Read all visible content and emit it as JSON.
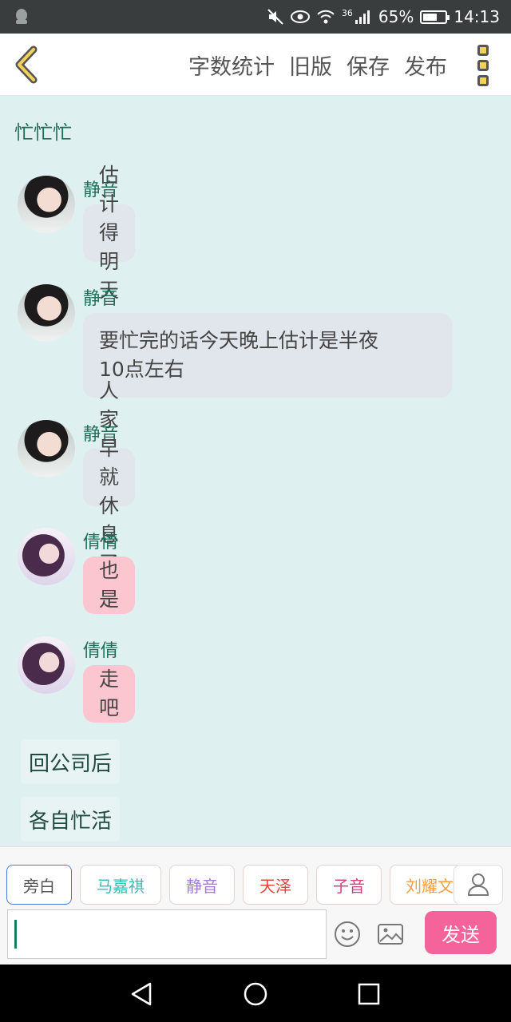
{
  "status_bar": {
    "battery_percent": "65%",
    "battery_level": 0.65,
    "time": "14:13",
    "network": "36"
  },
  "toolbar": {
    "actions": [
      "字数统计",
      "旧版",
      "保存",
      "发布"
    ]
  },
  "story": {
    "title": "忙忙忙"
  },
  "messages": [
    {
      "sender": "静音",
      "text": "估计得明天",
      "style": "gray"
    },
    {
      "sender": "静音",
      "text_line1": "要忙完的话今天晚上估计是半夜",
      "text_line2": "10点左右",
      "style": "gray"
    },
    {
      "sender": "静音",
      "text": "人家早就休息了",
      "style": "gray"
    },
    {
      "sender": "倩倩",
      "text": "也是",
      "style": "pink"
    },
    {
      "sender": "倩倩",
      "text": "走吧",
      "style": "pink"
    }
  ],
  "narrations": [
    "回公司后",
    "各自忙活"
  ],
  "characters": [
    {
      "name": "旁白",
      "color": "#555555"
    },
    {
      "name": "马嘉祺",
      "color": "#36bfb3"
    },
    {
      "name": "静音",
      "color": "#a87ad6"
    },
    {
      "name": "天泽",
      "color": "#e0463c"
    },
    {
      "name": "子音",
      "color": "#d6427f"
    },
    {
      "name": "刘耀文",
      "color": "#f0a048"
    }
  ],
  "composer": {
    "send_label": "发送",
    "accent_color": "#f4649a"
  }
}
